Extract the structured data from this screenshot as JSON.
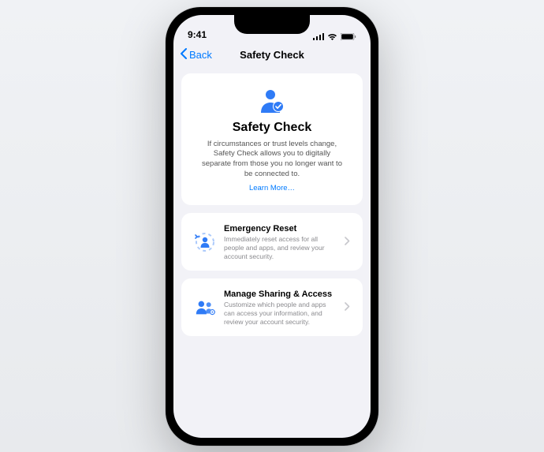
{
  "status": {
    "time": "9:41"
  },
  "nav": {
    "back_label": "Back",
    "title": "Safety Check"
  },
  "hero": {
    "title": "Safety Check",
    "description": "If circumstances or trust levels change, Safety Check allows you to digitally separate from those you no longer want to be connected to.",
    "learn_more": "Learn More…"
  },
  "options": {
    "emergency": {
      "title": "Emergency Reset",
      "description": "Immediately reset access for all people and apps, and review your account security."
    },
    "manage": {
      "title": "Manage Sharing & Access",
      "description": "Customize which people and apps can access your information, and review your account security."
    }
  },
  "colors": {
    "accent": "#007aff"
  }
}
